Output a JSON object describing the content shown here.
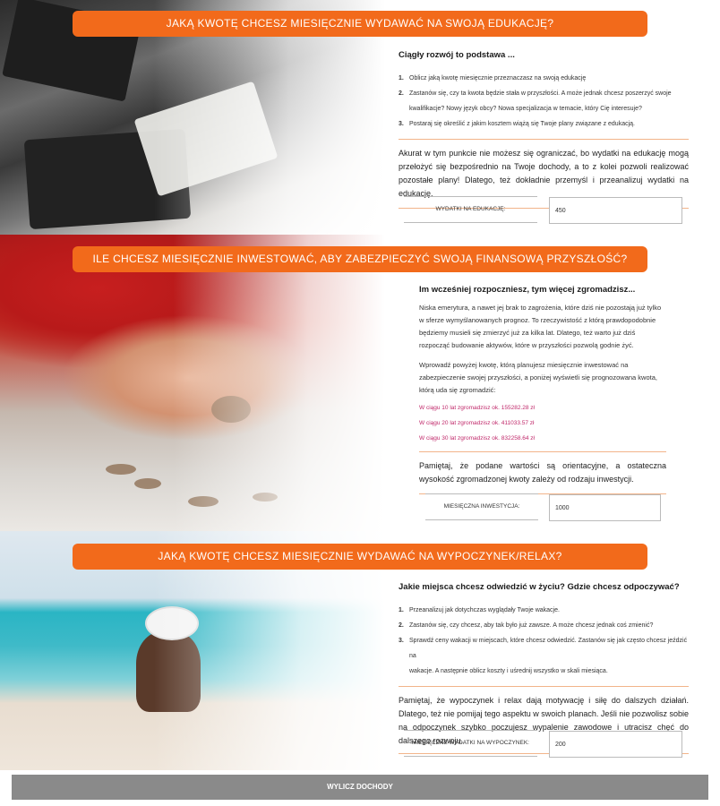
{
  "sections": [
    {
      "banner": "Jaką kwotę chcesz miesięcznie wydawać na swoją edukację?",
      "heading": "Ciągły rozwój to podstawa ...",
      "steps": [
        {
          "num": "1.",
          "text": "Oblicz jaką kwotę miesięcznie przeznaczasz na swoją edukację"
        },
        {
          "num": "2.",
          "text": "Zastanów się, czy ta kwota będzie stała w przyszłości. A może jednak chcesz poszerzyć swoje"
        },
        {
          "num": "",
          "text": "kwalifikacje? Nowy język obcy? Nowa specjalizacja w temacie, który Cię interesuje?"
        },
        {
          "num": "3.",
          "text": "Postaraj się określić z jakim kosztem wiążą się Twoje plany związane z edukacją."
        }
      ],
      "paragraph": "Akurat w tym punkcie nie możesz się ograniczać, bo wydatki na edukację mogą przełożyć się bezpośrednio na Twoje dochody, a to z kolei pozwoli realizować pozostałe plany! Dlatego, też dokładnie przemyśl i przeanalizuj wydatki na edukację.",
      "field_label": "Wydatki na edukację:",
      "field_value": "450"
    },
    {
      "banner": "Ile chcesz miesięcznie inwestować, aby zabezpieczyć swoją finansową przyszłość?",
      "heading": "Im wcześniej rozpoczniesz, tym więcej zgromadzisz...",
      "para1": "Niska emerytura, a nawet jej brak to zagrożenia, które dziś nie pozostają już tylko w sferze wymyślanowanych prognoz. To rzeczywistość z którą prawdopodobnie będziemy musieli się zmierzyć już za kilka lat. Dlatego, też warto już dziś rozpocząć budowanie aktywów, które w przyszłości pozwolą godnie żyć.",
      "para2": "Wprowadź powyżej kwotę, którą planujesz miesięcznie inwestować na zabezpieczenie swojej przyszłości, a poniżej wyświetli się prognozowana kwota, którą uda się zgromadzić:",
      "results": [
        "W ciągu 10 lat zgromadzisz ok. 155282.28 zł",
        "W ciągu 20 lat zgromadzisz ok. 411033.57 zł",
        "W ciągu 30 lat zgromadzisz ok. 832258.64 zł"
      ],
      "paragraph": "Pamiętaj, że podane wartości są orientacyjne, a ostateczna wysokość zgromadzonej kwoty zależy od rodzaju inwestycji.",
      "field_label": "Miesięczna inwestycja:",
      "field_value": "1000"
    },
    {
      "banner": "Jaką kwotę chcesz miesięcznie wydawać na wypoczynek/relax?",
      "heading": "Jakie miejsca chcesz odwiedzić w życiu? Gdzie chcesz odpoczywać?",
      "steps": [
        {
          "num": "1.",
          "text": "Przeanalizuj jak dotychczas wyglądały Twoje wakacje."
        },
        {
          "num": "2.",
          "text": "Zastanów się, czy chcesz, aby tak było już zawsze. A może chcesz jednak coś zmienić?"
        },
        {
          "num": "3.",
          "text": "Sprawdź ceny wakacji w miejscach, które chcesz odwiedzić. Zastanów się jak często chcesz jeździć na"
        },
        {
          "num": "",
          "text": "wakacje. A następnie oblicz koszty i uśrednij wszystko w skali miesiąca."
        }
      ],
      "paragraph": "Pamiętaj, że wypoczynek i relax dają motywację i siłę do dalszych działań. Dlatego, też nie pomijaj tego aspektu w swoich planach. Jeśli nie pozwolisz sobie na odpoczynek szybko poczujesz wypalenie zawodowe i utracisz chęć do dalszego rozwoju.",
      "field_label": "Miesięczne wydatki na wypoczynek:",
      "field_value": "200"
    }
  ],
  "calculate_button": "Wylicz dochody"
}
